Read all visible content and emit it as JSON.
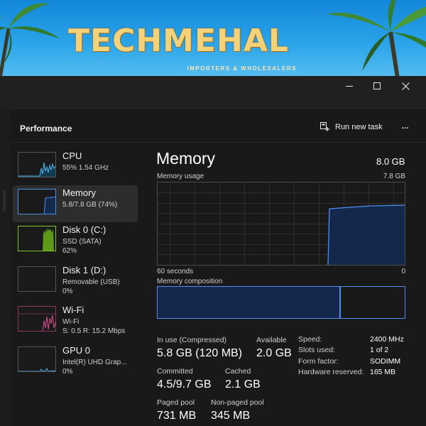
{
  "banner": {
    "logo_text": "TECHMEHAL",
    "logo_sub": "IMPORTERS & WHOLESALERS"
  },
  "colors": {
    "cpu": "#4fb6f0",
    "memory": "#4f8ff0",
    "disk": "#7ec424",
    "wifi": "#d6508e",
    "gpu": "#4fb6f0"
  },
  "header": {
    "title": "Performance",
    "run_new_task": "Run new task",
    "more": "..."
  },
  "sidebar": {
    "items": [
      {
        "name": "CPU",
        "sub1": "55%  1.54 GHz",
        "sub2": "",
        "sub3": "",
        "icon": "cpu-graph"
      },
      {
        "name": "Memory",
        "sub1": "5.8/7.8 GB (74%)",
        "sub2": "",
        "sub3": "",
        "icon": "memory-graph"
      },
      {
        "name": "Disk 0 (C:)",
        "sub1": "SSD (SATA)",
        "sub2": "62%",
        "sub3": "",
        "icon": "disk-graph"
      },
      {
        "name": "Disk 1 (D:)",
        "sub1": "Removable (USB)",
        "sub2": "0%",
        "sub3": "",
        "icon": "disk-graph"
      },
      {
        "name": "Wi-Fi",
        "sub1": "Wi-Fi",
        "sub2": "S: 0.5  R: 15.2 Mbps",
        "sub3": "",
        "icon": "network-graph"
      },
      {
        "name": "GPU 0",
        "sub1": "Intel(R) UHD Grap...",
        "sub2": "0%",
        "sub3": "",
        "icon": "gpu-graph"
      }
    ]
  },
  "memory": {
    "title": "Memory",
    "total": "8.0 GB",
    "usage_label": "Memory usage",
    "usage_max": "7.8 GB",
    "time_left": "60 seconds",
    "time_right": "0",
    "composition_label": "Memory composition",
    "in_use_fraction": 0.74,
    "stats": {
      "in_use_label": "In use (Compressed)",
      "in_use_value": "5.8 GB (120 MB)",
      "available_label": "Available",
      "available_value": "2.0 GB",
      "committed_label": "Committed",
      "committed_value": "4.5/9.7 GB",
      "cached_label": "Cached",
      "cached_value": "2.1 GB",
      "paged_label": "Paged pool",
      "paged_value": "731 MB",
      "nonpaged_label": "Non-paged pool",
      "nonpaged_value": "345 MB"
    },
    "specs": [
      {
        "label": "Speed:",
        "value": "2400 MHz"
      },
      {
        "label": "Slots used:",
        "value": "1 of 2"
      },
      {
        "label": "Form factor:",
        "value": "SODIMM"
      },
      {
        "label": "Hardware reserved:",
        "value": "165 MB"
      }
    ]
  }
}
